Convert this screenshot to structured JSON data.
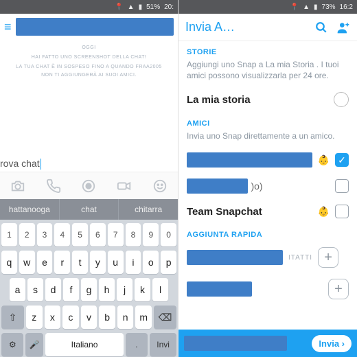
{
  "left": {
    "status": {
      "battery": "51%",
      "time": "20:"
    },
    "meta_day": "OGGI",
    "meta_line1": "HAI FATTO UNO SCREENSHOT DELLA CHAT!",
    "meta_line2": "LA TUA CHAT È IN SOSPESO FINO A QUANDO FRAA2005 NON TI AGGIUNGERÀ AI SUOI AMICI.",
    "input_value": "rova chat",
    "suggestions": [
      "hattanooga",
      "chat",
      "chitarra"
    ],
    "keys_num": [
      "1",
      "2",
      "3",
      "4",
      "5",
      "6",
      "7",
      "8",
      "9",
      "0"
    ],
    "keys_r1": [
      "q",
      "w",
      "e",
      "r",
      "t",
      "y",
      "u",
      "i",
      "o",
      "p"
    ],
    "keys_r2": [
      "a",
      "s",
      "d",
      "f",
      "g",
      "h",
      "j",
      "k",
      "l"
    ],
    "keys_r3": [
      "z",
      "x",
      "c",
      "v",
      "b",
      "n",
      "m"
    ],
    "shift": "⇧",
    "bksp": "⌫",
    "sym": "⚙",
    "mic": "🎤",
    "space": "Italiano",
    "send_key": "Invi"
  },
  "right": {
    "status": {
      "battery": "73%",
      "time": "16:2"
    },
    "title": "Invia A…",
    "sections": {
      "storie": {
        "header": "STORIE",
        "sub": "Aggiungi uno Snap a La mia Storia . I tuoi amici possono visualizzarla per 24 ore.",
        "item": "La mia storia"
      },
      "amici": {
        "header": "AMICI",
        "sub": "Invia uno Snap direttamente a un amico.",
        "f2_suffix": ")o)",
        "f3": "Team Snapchat"
      },
      "quick": {
        "header": "AGGIUNTA RAPIDA",
        "contacts": "ITATTI"
      }
    },
    "send": "Invia ›"
  }
}
